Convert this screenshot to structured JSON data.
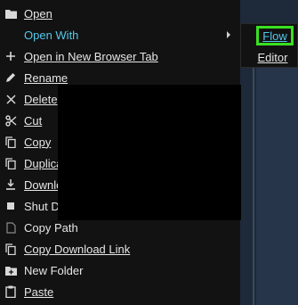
{
  "menu": {
    "items": [
      {
        "label": "Open",
        "icon": "folder-icon",
        "underline": true
      },
      {
        "label": "Open With",
        "icon": "none",
        "submenu": true
      },
      {
        "label": "Open in New Browser Tab",
        "icon": "plus-icon",
        "underline": true
      },
      {
        "label": "Rename",
        "icon": "pencil-icon",
        "underline": true
      },
      {
        "label": "Delete",
        "icon": "close-icon",
        "underline": true
      },
      {
        "label": "Cut",
        "icon": "scissors-icon",
        "underline": true
      },
      {
        "label": "Copy",
        "icon": "copy-icon",
        "underline": true
      },
      {
        "label": "Duplica",
        "icon": "duplicate-icon",
        "underline": true
      },
      {
        "label": "Downlo",
        "icon": "download-icon",
        "underline": true
      },
      {
        "label": "Shut Do",
        "icon": "stop-icon"
      },
      {
        "label": "Copy Path",
        "icon": "file-icon"
      },
      {
        "label": "Copy Download Link",
        "icon": "copy-link-icon",
        "underline": true
      },
      {
        "label": "New Folder",
        "icon": "new-folder-icon"
      },
      {
        "label": "Paste",
        "icon": "clipboard-icon",
        "underline": true
      }
    ]
  },
  "submenu": {
    "items": [
      {
        "label": "Flow",
        "highlighted": true,
        "highlight_color": "#39e021"
      },
      {
        "label": "Editor"
      }
    ]
  },
  "colors": {
    "background": "#121212",
    "accent_text": "#54c8ea",
    "highlight_border": "#39e021"
  }
}
